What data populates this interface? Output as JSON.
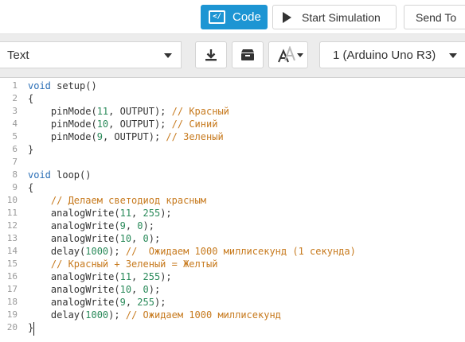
{
  "toolbar": {
    "code_label": "Code",
    "code_icon_glyph": "</",
    "start_sim_label": "Start Simulation",
    "send_label": "Send To"
  },
  "editor_toolbar": {
    "mode_value": "Text",
    "board_value": "1 (Arduino Uno R3)",
    "download_icon": "download-icon",
    "library_icon": "library-icon",
    "font_icon": "font-size-icon"
  },
  "code": {
    "lines": [
      "void setup()",
      "{",
      "    pinMode(11, OUTPUT); // Красный",
      "    pinMode(10, OUTPUT); // Синий",
      "    pinMode(9, OUTPUT); // Зеленый",
      "}",
      "",
      "void loop()",
      "{",
      "    // Делаем светодиод красным",
      "    analogWrite(11, 255);",
      "    analogWrite(9, 0);",
      "    analogWrite(10, 0);",
      "    delay(1000); //  Ожидаем 1000 миллисекунд (1 секунда)",
      "    // Красный + Зеленый = Желтый",
      "    analogWrite(11, 255);",
      "    analogWrite(10, 0);",
      "    analogWrite(9, 255);",
      "    delay(1000); // Ожидаем 1000 миллисекунд",
      "}"
    ]
  },
  "colors": {
    "accent": "#1d95d3",
    "keyword": "#2b6fb6",
    "number": "#2a8a5a",
    "comment": "#c77a1e"
  }
}
